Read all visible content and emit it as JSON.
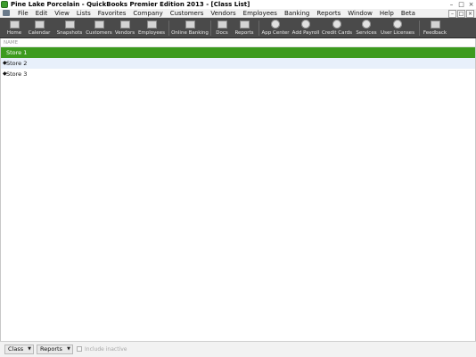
{
  "window": {
    "title": "Pine Lake Porcelain  - QuickBooks Premier Edition 2013 - [Class List]",
    "controls": [
      "–",
      "□",
      "×"
    ]
  },
  "menubar": {
    "items": [
      "File",
      "Edit",
      "View",
      "Lists",
      "Favorites",
      "Company",
      "Customers",
      "Vendors",
      "Employees",
      "Banking",
      "Reports",
      "Window",
      "Help",
      "Beta"
    ],
    "mdi_controls": [
      "–",
      "□",
      "×"
    ]
  },
  "toolbar": {
    "items": [
      {
        "label": "Home",
        "icon": "home-icon"
      },
      {
        "label": "Calendar",
        "icon": "calendar-icon"
      },
      {
        "label": "Snapshots",
        "icon": "snapshots-icon"
      },
      {
        "label": "Customers",
        "icon": "customers-icon"
      },
      {
        "label": "Vendors",
        "icon": "vendors-icon"
      },
      {
        "label": "Employees",
        "icon": "employees-icon"
      },
      {
        "label": "Online Banking",
        "icon": "bank-icon"
      },
      {
        "label": "Docs",
        "icon": "docs-icon"
      },
      {
        "label": "Reports",
        "icon": "reports-icon"
      },
      {
        "label": "App Center",
        "icon": "app-center-icon"
      },
      {
        "label": "Add Payroll",
        "icon": "payroll-icon"
      },
      {
        "label": "Credit Cards",
        "icon": "credit-card-icon"
      },
      {
        "label": "Services",
        "icon": "services-icon"
      },
      {
        "label": "User Licenses",
        "icon": "user-licenses-icon"
      },
      {
        "label": "Feedback",
        "icon": "feedback-icon"
      }
    ]
  },
  "list": {
    "column_header": "NAME",
    "rows": [
      {
        "name": "Store 1",
        "selected": true
      },
      {
        "name": "Store 2",
        "selected": false
      },
      {
        "name": "Store 3",
        "selected": false
      }
    ]
  },
  "bottombar": {
    "class_button": "Class",
    "reports_button": "Reports",
    "include_inactive_label": "Include inactive"
  },
  "colors": {
    "selected_row": "#3d9b1f",
    "toolbar_bg": "#4a4a4a",
    "alt_row": "#e8f0fb"
  }
}
